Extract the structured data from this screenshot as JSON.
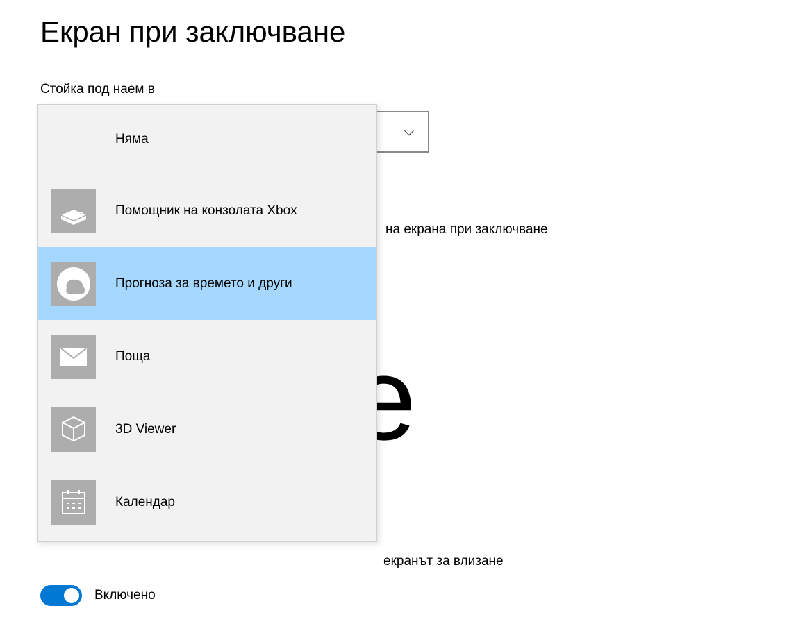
{
  "page": {
    "title": "Екран при заключване",
    "subtitle": "Стойка под наем в"
  },
  "dropdown": {
    "items": [
      {
        "label": "Няма"
      },
      {
        "label": "Помощник на конзолата Xbox"
      },
      {
        "label": "Прогноза за времето и други"
      },
      {
        "label": "Поща"
      },
      {
        "label": "3D Viewer"
      },
      {
        "label": "Календар"
      }
    ]
  },
  "background": {
    "text1": "на екрана при заключване",
    "big_letter": "e",
    "text2": "екранът за влизане"
  },
  "toggle": {
    "label": "Включено"
  }
}
